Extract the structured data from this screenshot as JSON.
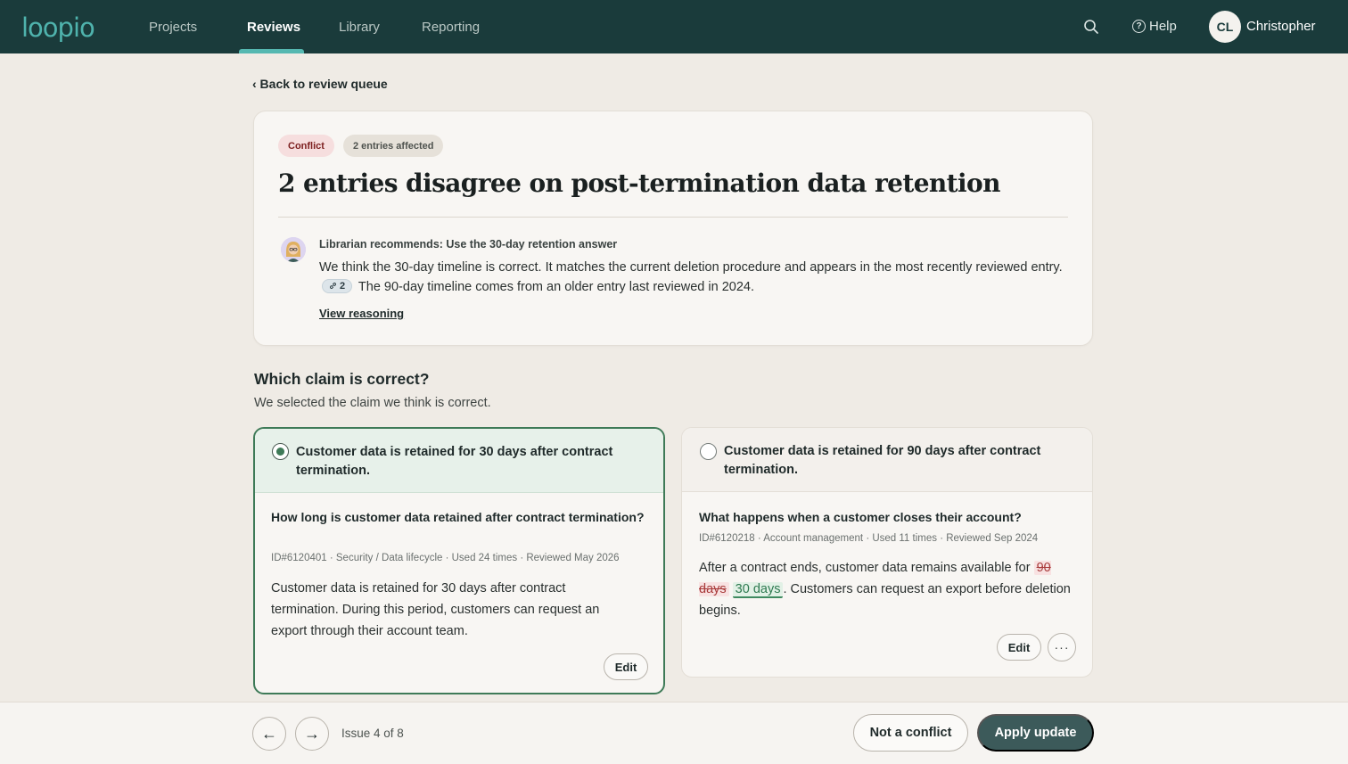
{
  "app": {
    "logo": "loopio",
    "nav": {
      "projects": "Projects",
      "reviews": "Reviews",
      "library": "Library",
      "reporting": "Reporting",
      "active": "Reviews"
    },
    "help_label": "Help",
    "user": {
      "initials": "CL",
      "name": "Christopher"
    }
  },
  "back_link": "‹ Back to review queue",
  "issue": {
    "badge_type": "Conflict",
    "badge_count": "2 entries affected",
    "title": "2 entries disagree on post-termination data retention",
    "recommendation_title": "Librarian recommends: Use the 30-day retention answer",
    "recommendation_part1": "We think the 30-day timeline is correct. It matches the current deletion procedure and appears in the most recently reviewed entry.",
    "citation_count": "2",
    "recommendation_part2": "The 90-day timeline comes from an older entry last reviewed in 2024.",
    "view_reasoning": "View reasoning"
  },
  "question": {
    "title": "Which claim is correct?",
    "subtitle": "We selected the claim we think is correct."
  },
  "claims": [
    {
      "selected": true,
      "claim": "Customer data is retained for 30 days after contract termination.",
      "entry_question": "How long is customer data retained after contract termination?",
      "meta": "ID#6120401 · Security / Data lifecycle · Used 24 times · Reviewed May 2026",
      "body": "Customer data is retained for 30 days after contract termination. During this period, customers can request an export through their account team.",
      "edit_label": "Edit"
    },
    {
      "selected": false,
      "claim": "Customer data is retained for 90 days after contract termination.",
      "entry_question": "What happens when a customer closes their account?",
      "meta": "ID#6120218 · Account management · Used 11 times · Reviewed Sep 2024",
      "body_before": "After a contract ends, customer data remains available for",
      "body_removed": "90 days",
      "body_inserted": "30 days",
      "body_after": ". Customers can request an export before deletion begins.",
      "edit_label": "Edit",
      "more_label": "···"
    }
  ],
  "footer": {
    "prev_arrow": "←",
    "next_arrow": "→",
    "issue_counter": "Issue 4 of 8",
    "not_conflict": "Not a conflict",
    "apply_update": "Apply update"
  },
  "colors": {
    "nav_bg": "#1a3b3b",
    "accent": "#55b8b1",
    "selected_border": "#3e7a57",
    "primary_button": "#3c5a5a"
  }
}
